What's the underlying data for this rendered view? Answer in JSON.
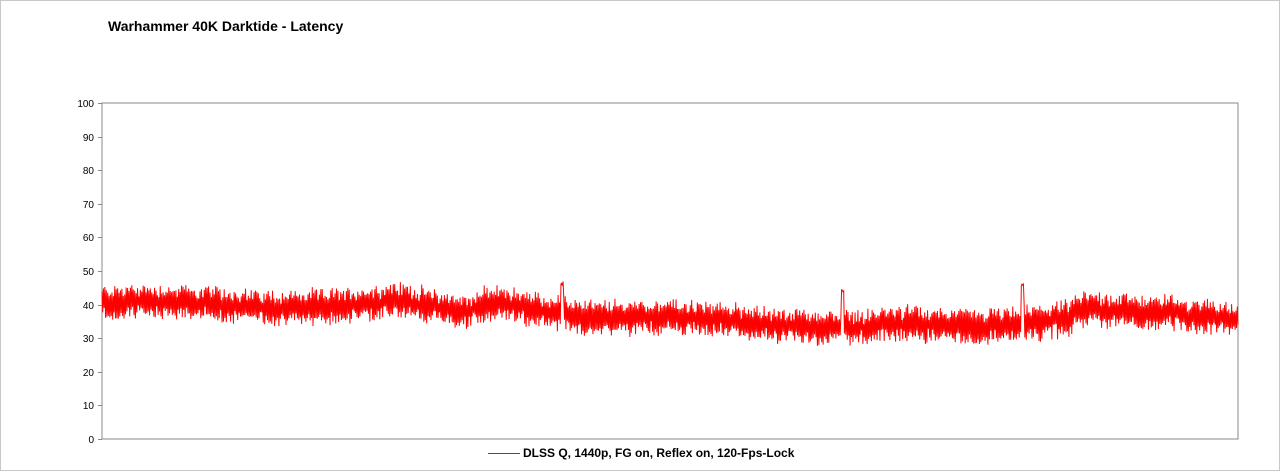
{
  "chart_data": {
    "type": "line",
    "title": "Warhammer 40K Darktide - Latency",
    "xlabel": "",
    "ylabel": "",
    "ylim": [
      0,
      100
    ],
    "yticks": [
      0,
      10,
      20,
      30,
      40,
      50,
      60,
      70,
      80,
      90,
      100
    ],
    "grid": false,
    "legend_position": "bottom",
    "samples": 1600,
    "series": [
      {
        "name": "DLSS Q, 1440p, FG on, Reflex on, 120-Fps-Lock",
        "color": "#ff0000",
        "profile": [
          [
            0.0,
            40.5
          ],
          [
            0.04,
            41.0
          ],
          [
            0.08,
            40.5
          ],
          [
            0.12,
            39.5
          ],
          [
            0.16,
            39.0
          ],
          [
            0.2,
            39.5
          ],
          [
            0.24,
            40.5
          ],
          [
            0.26,
            41.5
          ],
          [
            0.3,
            39.0
          ],
          [
            0.32,
            37.5
          ],
          [
            0.34,
            40.5
          ],
          [
            0.36,
            40.0
          ],
          [
            0.38,
            38.5
          ],
          [
            0.4,
            37.5
          ],
          [
            0.42,
            36.5
          ],
          [
            0.44,
            36.0
          ],
          [
            0.48,
            36.5
          ],
          [
            0.52,
            36.0
          ],
          [
            0.56,
            35.0
          ],
          [
            0.6,
            33.5
          ],
          [
            0.64,
            33.0
          ],
          [
            0.68,
            33.5
          ],
          [
            0.7,
            34.5
          ],
          [
            0.74,
            34.0
          ],
          [
            0.78,
            33.5
          ],
          [
            0.82,
            34.5
          ],
          [
            0.85,
            36.0
          ],
          [
            0.86,
            38.5
          ],
          [
            0.87,
            39.0
          ],
          [
            0.9,
            38.0
          ],
          [
            0.94,
            37.5
          ],
          [
            0.97,
            36.5
          ],
          [
            1.0,
            35.5
          ]
        ],
        "amplitude": 5,
        "spikes": [
          {
            "x": 0.405,
            "y": 47
          },
          {
            "x": 0.652,
            "y": 45
          },
          {
            "x": 0.81,
            "y": 46.5
          }
        ]
      }
    ]
  }
}
